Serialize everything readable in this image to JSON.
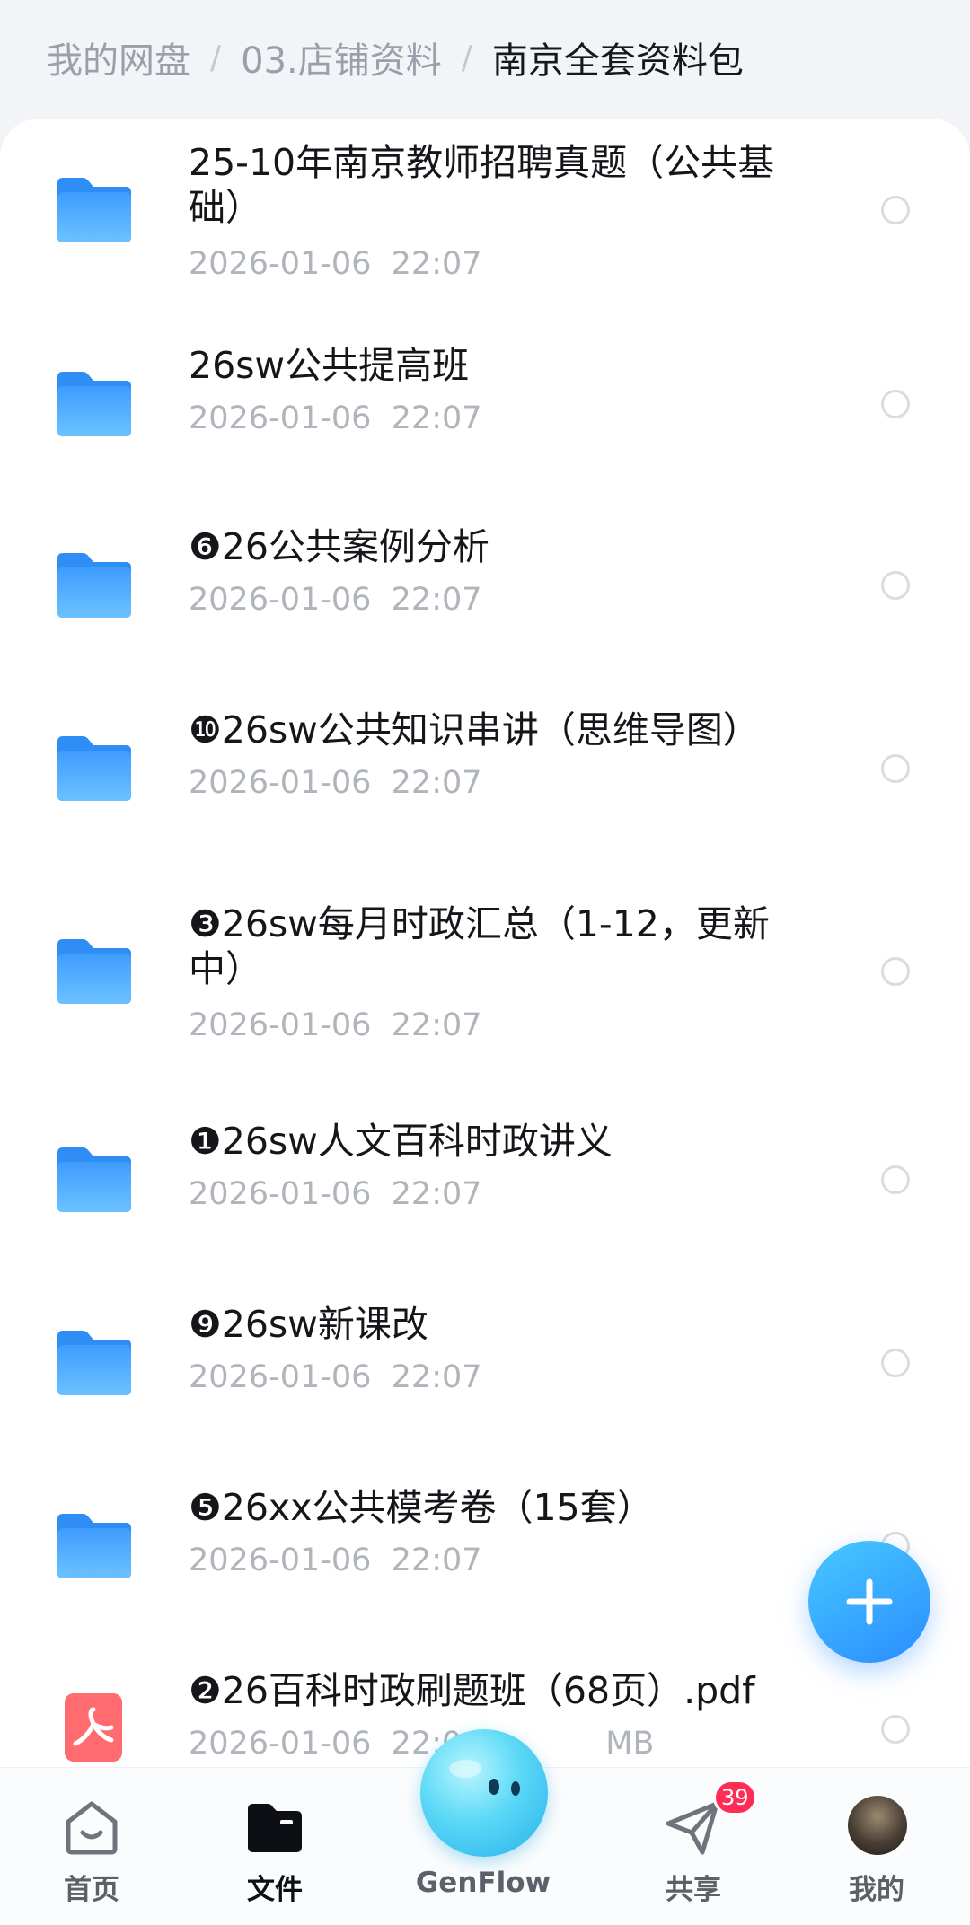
{
  "breadcrumb": [
    "我的网盘",
    "03.店铺资料",
    "南京全套资料包"
  ],
  "breadcrumb_separator": "/",
  "files": [
    {
      "name": "25-10年南京教师招聘真题（公共基础）",
      "meta": "2026-01-06  22:07",
      "type": "folder"
    },
    {
      "name": "26sw公共提高班",
      "meta": "2026-01-06  22:07",
      "type": "folder"
    },
    {
      "name": "❻26公共案例分析",
      "meta": "2026-01-06  22:07",
      "type": "folder"
    },
    {
      "name": "❿26sw公共知识串讲（思维导图）",
      "meta": "2026-01-06  22:07",
      "type": "folder"
    },
    {
      "name": "❸26sw每月时政汇总（1-12，更新中）",
      "meta": "2026-01-06  22:07",
      "type": "folder"
    },
    {
      "name": "❶26sw人文百科时政讲义",
      "meta": "2026-01-06  22:07",
      "type": "folder"
    },
    {
      "name": "❾26sw新课改",
      "meta": "2026-01-06  22:07",
      "type": "folder"
    },
    {
      "name": "❺26xx公共模考卷（15套）",
      "meta": "2026-01-06  22:07",
      "type": "folder"
    },
    {
      "name": "❷26百科时政刷题班（68页）.pdf",
      "meta": "2026-01-06  22:0",
      "meta_suffix": "MB",
      "type": "pdf"
    }
  ],
  "tabs": [
    {
      "label": "首页",
      "icon": "home-icon",
      "active": false
    },
    {
      "label": "文件",
      "icon": "folder-icon",
      "active": true
    },
    {
      "label": "GenFlow",
      "icon": "genflow-orb-icon",
      "active": false
    },
    {
      "label": "共享",
      "icon": "paper-plane-icon",
      "active": false,
      "badge": "39"
    },
    {
      "label": "我的",
      "icon": "avatar",
      "active": false
    }
  ],
  "colors": {
    "accent": "#2a8cff",
    "folder": "#4aa8ff",
    "pdf": "#ff5a5f",
    "badge": "#ff2d55"
  }
}
